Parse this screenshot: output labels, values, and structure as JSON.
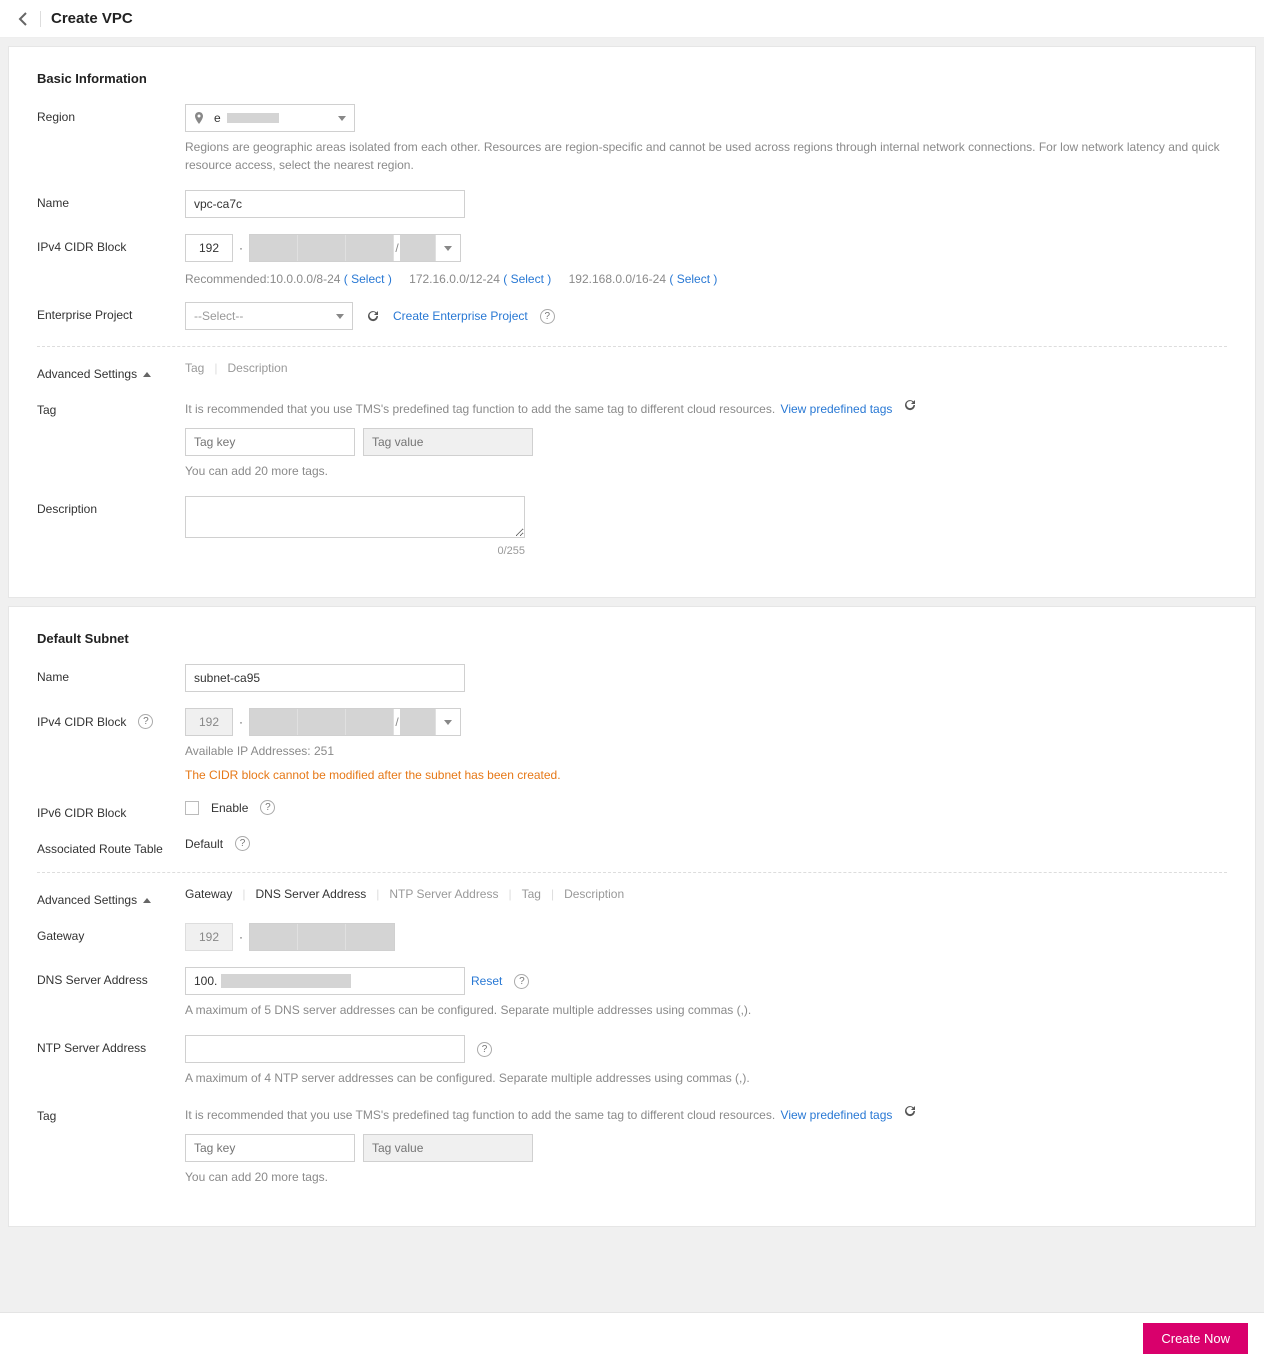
{
  "header": {
    "title": "Create VPC"
  },
  "basic": {
    "section_title": "Basic Information",
    "region_label": "Region",
    "region_value_prefix": "e",
    "region_hint": "Regions are geographic areas isolated from each other. Resources are region-specific and cannot be used across regions through internal network connections. For low network latency and quick resource access, select the nearest region.",
    "name_label": "Name",
    "name_value": "vpc-ca7c",
    "cidr_label": "IPv4 CIDR Block",
    "cidr_first_octet": "192",
    "rec_prefix": "Recommended:",
    "rec": [
      {
        "text": "10.0.0.0/8-24",
        "action": "( Select )"
      },
      {
        "text": "172.16.0.0/12-24",
        "action": "( Select )"
      },
      {
        "text": "192.168.0.0/16-24",
        "action": "( Select )"
      }
    ],
    "ep_label": "Enterprise Project",
    "ep_placeholder": "--Select--",
    "ep_create": "Create Enterprise Project",
    "adv_label": "Advanced Settings",
    "adv_pills": [
      "Tag",
      "Description"
    ],
    "tag_label": "Tag",
    "tag_hint": "It is recommended that you use TMS's predefined tag function to add the same tag to different cloud resources.",
    "tag_link": "View predefined tags",
    "tag_key_ph": "Tag key",
    "tag_val_ph": "Tag value",
    "tag_count_hint": "You can add 20 more tags.",
    "desc_label": "Description",
    "desc_counter": "0/255"
  },
  "subnet": {
    "section_title": "Default Subnet",
    "name_label": "Name",
    "name_value": "subnet-ca95",
    "cidr_label": "IPv4 CIDR Block",
    "cidr_first_octet": "192",
    "avail_ip": "Available IP Addresses: 251",
    "cidr_warn": "The CIDR block cannot be modified after the subnet has been created.",
    "ipv6_label": "IPv6 CIDR Block",
    "ipv6_enable": "Enable",
    "route_label": "Associated Route Table",
    "route_value": "Default",
    "adv_label": "Advanced Settings",
    "adv_pills": [
      "Gateway",
      "DNS Server Address",
      "NTP Server Address",
      "Tag",
      "Description"
    ],
    "adv_active": [
      0,
      1
    ],
    "gw_label": "Gateway",
    "gw_first_octet": "192",
    "dns_label": "DNS Server Address",
    "dns_prefix": "100.",
    "dns_reset": "Reset",
    "dns_hint": "A maximum of 5 DNS server addresses can be configured. Separate multiple addresses using commas (,).",
    "ntp_label": "NTP Server Address",
    "ntp_hint": "A maximum of 4 NTP server addresses can be configured. Separate multiple addresses using commas (,).",
    "tag_label": "Tag",
    "tag_hint": "It is recommended that you use TMS's predefined tag function to add the same tag to different cloud resources.",
    "tag_link": "View predefined tags",
    "tag_key_ph": "Tag key",
    "tag_val_ph": "Tag value",
    "tag_count_hint": "You can add 20 more tags."
  },
  "footer": {
    "create": "Create Now"
  }
}
